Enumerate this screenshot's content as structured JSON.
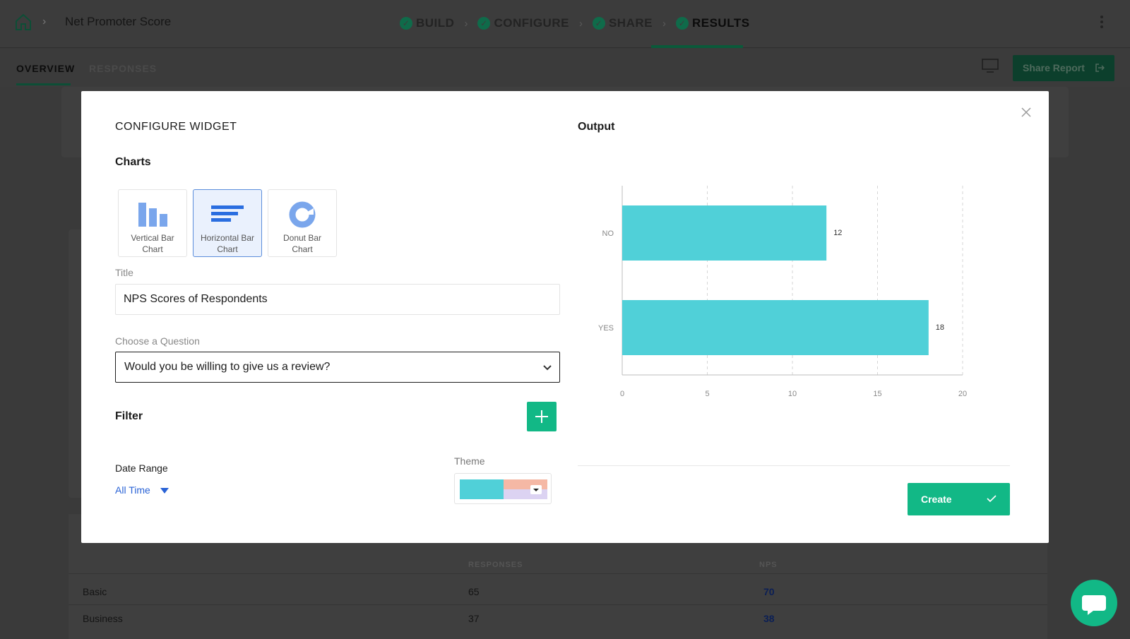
{
  "app": {
    "title": "Net Promoter Score",
    "steps": [
      "BUILD",
      "CONFIGURE",
      "SHARE",
      "RESULTS"
    ],
    "active_step": "RESULTS"
  },
  "subnav": {
    "tabs": [
      "OVERVIEW",
      "RESPONSES"
    ],
    "active_tab": "OVERVIEW",
    "share_label": "Share Report"
  },
  "background_table": {
    "headers": [
      "RESPONSES",
      "NPS"
    ],
    "rows": [
      {
        "name": "Basic",
        "responses": "65",
        "nps": "70"
      },
      {
        "name": "Business",
        "responses": "37",
        "nps": "38"
      }
    ]
  },
  "modal": {
    "heading": "CONFIGURE WIDGET",
    "charts_heading": "Charts",
    "chart_options": [
      {
        "label": "Vertical Bar\nChart",
        "icon": "vertical-bar-chart-icon"
      },
      {
        "label": "Horizontal Bar\nChart",
        "icon": "horizontal-bar-chart-icon",
        "selected": true
      },
      {
        "label": "Donut Bar\nChart",
        "icon": "donut-chart-icon"
      }
    ],
    "title_label": "Title",
    "title_value": "NPS Scores of Respondents",
    "question_label": "Choose a Question",
    "question_value": "Would you be willing to give us a review?",
    "filter_heading": "Filter",
    "date_range_label": "Date Range",
    "date_range_value": "All Time",
    "theme_label": "Theme",
    "theme_colors": [
      "#50d0d8",
      "#f5b8a5",
      "#dcd3f2"
    ],
    "output_heading": "Output",
    "create_label": "Create"
  },
  "chart_data": {
    "type": "bar",
    "orientation": "horizontal",
    "categories": [
      "NO",
      "YES"
    ],
    "values": [
      12,
      18
    ],
    "xlim": [
      0,
      20
    ],
    "xticks": [
      0,
      5,
      10,
      15,
      20
    ],
    "bar_color": "#50d0d8",
    "grid": true
  },
  "colors": {
    "accent": "#12b886",
    "link": "#2a63d6",
    "selected_border": "#5b8ddb"
  }
}
